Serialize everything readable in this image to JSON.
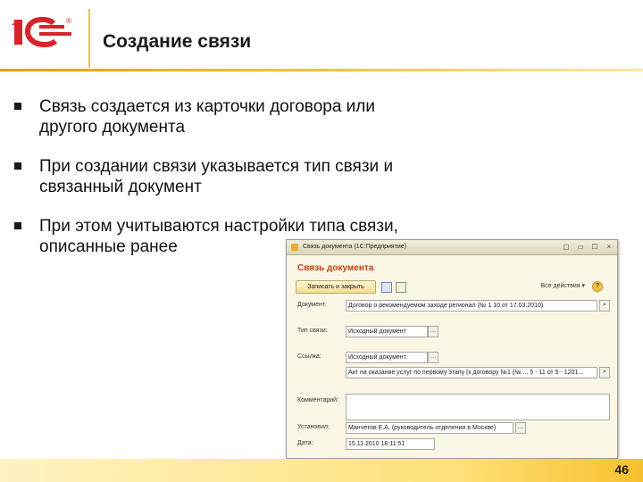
{
  "header": {
    "title": "Создание связи",
    "logo_text": "1С",
    "logo_mark": "®"
  },
  "bullets": [
    {
      "line1": "Связь создается из карточки договора или",
      "line2": "другого документа"
    },
    {
      "line1": "При создании связи указывается тип связи и",
      "line2": "связанный документ"
    },
    {
      "line1": "При этом учитываются настройки типа связи,",
      "line2": "описанные ранее"
    }
  ],
  "window": {
    "title": "Связь документа (1С:Предприятие)",
    "controls": [
      "▢",
      "▭",
      "☐",
      "×"
    ],
    "form_header": "Связь документа",
    "toolbar": {
      "save_close": "Записать и закрыть",
      "all_actions": "Все действия ▾",
      "help": "?"
    },
    "fields": {
      "document_label": "Документ:",
      "document_value": "Договор о рекомендуемом заходе регионал (№ 1 10 от 17.03.2010)",
      "link_type_label": "Тип связи:",
      "link_type_value": "Исходный документ",
      "link_label": "Ссылка:",
      "link_value_1": "Исходный документ",
      "link_value_2": "Акт на оказание услуг по первому этапу (к договору №1 (№ ... 5 - 11 от 5 - 1201...",
      "comment_label": "Комментарий:",
      "comment_value": "",
      "installed_label": "Установил:",
      "installed_value": "Манчетов Е.А. (руководитель отделения в Москве)",
      "date_label": "Дата:",
      "date_value": "15.11.2010 18:11:51"
    }
  },
  "page_number": "46"
}
